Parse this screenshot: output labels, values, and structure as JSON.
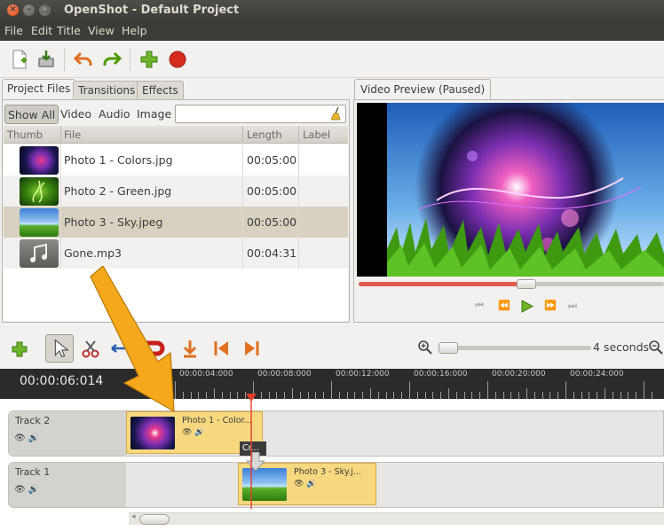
{
  "window": {
    "title": "OpenShot - Default Project"
  },
  "menu": [
    "File",
    "Edit",
    "Title",
    "View",
    "Help"
  ],
  "toolbar": [
    "new-project-icon",
    "save-project-icon",
    "undo-icon",
    "redo-icon",
    "add-files-icon",
    "record-icon"
  ],
  "tabs": {
    "project_files": "Project Files",
    "transitions": "Transitions",
    "effects": "Effects"
  },
  "filters": {
    "show_all": "Show All",
    "video": "Video",
    "audio": "Audio",
    "image": "Image"
  },
  "search": {
    "value": ""
  },
  "file_columns": {
    "thumb": "Thumb",
    "file": "File",
    "length": "Length",
    "label": "Label"
  },
  "files": [
    {
      "name": "Photo 1 - Colors.jpg",
      "length": "00:05:00",
      "label": ""
    },
    {
      "name": "Photo 2 - Green.jpg",
      "length": "00:05:00",
      "label": ""
    },
    {
      "name": "Photo 3 - Sky.jpeg",
      "length": "00:05:00",
      "label": ""
    },
    {
      "name": "Gone.mp3",
      "length": "00:04:31",
      "label": ""
    }
  ],
  "preview": {
    "tab": "Video Preview (Paused)",
    "progress": 0.55
  },
  "zoom": {
    "label": "4 seconds"
  },
  "timeline": {
    "timecode": "00:00:06:014",
    "ticks": [
      "00:00:04:000",
      "00:00:08:000",
      "00:00:12:000",
      "00:00:16:000",
      "00:00:20:000",
      "00:00:24:000"
    ],
    "tracks": [
      {
        "name": "Track 2",
        "clip": "Photo 1 - Color..."
      },
      {
        "name": "Track 1",
        "clip": "Photo 3 - Sky.j..."
      }
    ],
    "tooltip": "Cr..."
  },
  "colors": {
    "accent": "#e05d4e",
    "clip": "#f8d87f",
    "annotation_arrow": "#f5a81c"
  }
}
